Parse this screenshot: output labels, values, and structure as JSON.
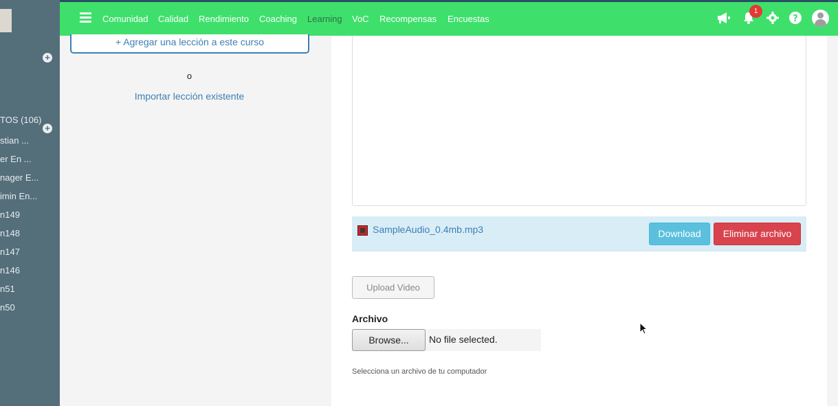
{
  "sidebar": {
    "section_title": "TOS (106)",
    "items": [
      "stian ...",
      "er En ...",
      "nager E...",
      "imin En...",
      "n149",
      "n148",
      "n147",
      "n146",
      "n51",
      "n50"
    ]
  },
  "topbar": {
    "nav": [
      "Comunidad",
      "Calidad",
      "Rendimiento",
      "Coaching",
      "Learning",
      "VoC",
      "Recompensas",
      "Encuestas"
    ],
    "active": "Learning",
    "notification_count": "1"
  },
  "lessons": {
    "add_label": "+ Agregar una lección a este curso",
    "or_text": "o",
    "import_label": "Importar lección existente"
  },
  "attachment": {
    "file_name": "SampleAudio_0.4mb.mp3",
    "download_label": "Download",
    "delete_label": "Eliminar archivo"
  },
  "upload": {
    "video_label": "Upload Video",
    "archivo_label": "Archivo",
    "browse_label": "Browse...",
    "no_file_text": "No file selected.",
    "help_text": "Selecciona un archivo de tu computador"
  },
  "colors": {
    "topbar": "#3ee06b",
    "sidebar": "#546e7a",
    "link": "#3d7fb4",
    "download": "#5bc0de",
    "delete": "#d9434e"
  }
}
